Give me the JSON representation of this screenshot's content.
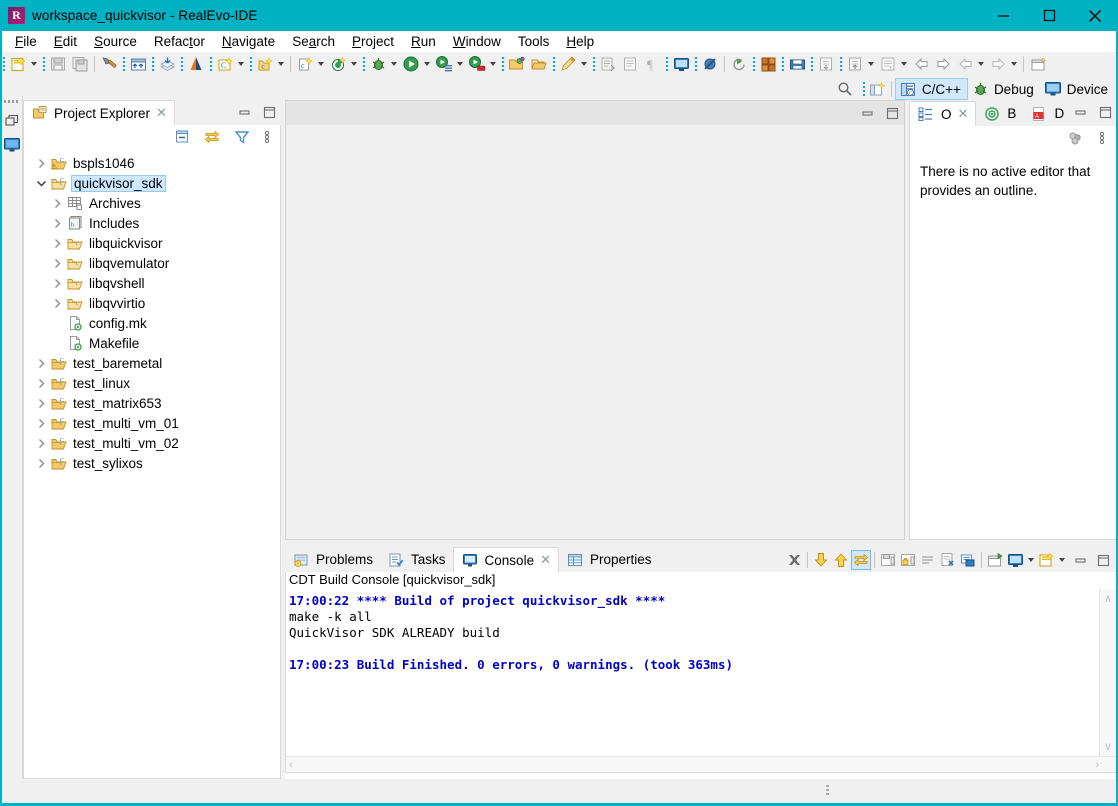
{
  "window": {
    "title": "workspace_quickvisor - RealEvo-IDE",
    "logo_letter": "R",
    "minimize": "—",
    "maximize": "□",
    "close": "✕",
    "accent_color": "#00b2c2"
  },
  "menubar": {
    "items": [
      {
        "label": "File",
        "mnemonic": "F"
      },
      {
        "label": "Edit",
        "mnemonic": "E"
      },
      {
        "label": "Source",
        "mnemonic": "S"
      },
      {
        "label": "Refactor",
        "mnemonic": "t"
      },
      {
        "label": "Navigate",
        "mnemonic": "N"
      },
      {
        "label": "Search",
        "mnemonic": "a"
      },
      {
        "label": "Project",
        "mnemonic": "P"
      },
      {
        "label": "Run",
        "mnemonic": "R"
      },
      {
        "label": "Window",
        "mnemonic": "W"
      },
      {
        "label": "Tools",
        "mnemonic": ""
      },
      {
        "label": "Help",
        "mnemonic": "H"
      }
    ]
  },
  "toolbar": {
    "groups": [
      {
        "items": [
          {
            "icon": "new-wizard-icon",
            "arrow": true
          },
          {
            "icon": "save-icon",
            "arrow": false
          },
          {
            "icon": "save-all-icon",
            "arrow": false
          }
        ]
      },
      {
        "items": [
          {
            "icon": "build-hammer-icon",
            "arrow": false
          }
        ]
      },
      {
        "items": [
          {
            "icon": "build-all-icon",
            "arrow": false
          }
        ]
      },
      {
        "items": [
          {
            "icon": "publish-icon",
            "arrow": false
          }
        ]
      },
      {
        "items": [
          {
            "icon": "realevo-tool-icon",
            "arrow": false
          }
        ]
      },
      {
        "items": [
          {
            "icon": "new-c-project-icon",
            "arrow": true
          }
        ]
      },
      {
        "items": [
          {
            "icon": "new-c-class-icon",
            "arrow": true
          }
        ]
      },
      {
        "items": [
          {
            "icon": "new-c-file-icon",
            "arrow": true
          }
        ]
      },
      {
        "items": [
          {
            "icon": "new-grid-icon",
            "arrow": true
          }
        ]
      },
      {
        "items": [
          {
            "icon": "debug-bug-icon",
            "arrow": true
          },
          {
            "icon": "run-icon",
            "arrow": true
          },
          {
            "icon": "run-config-icon",
            "arrow": true
          },
          {
            "icon": "run-stop-icon",
            "arrow": true
          }
        ]
      },
      {
        "items": [
          {
            "icon": "open-type-icon",
            "arrow": false
          },
          {
            "icon": "open-resource-icon",
            "arrow": false
          }
        ]
      },
      {
        "items": [
          {
            "icon": "pencil-marker-icon",
            "arrow": true
          }
        ]
      },
      {
        "items": [
          {
            "icon": "next-annotation-icon",
            "arrow": false
          },
          {
            "icon": "last-edit-icon",
            "arrow": false
          },
          {
            "icon": "pilcrow-icon",
            "arrow": false
          }
        ]
      },
      {
        "items": [
          {
            "icon": "console-monitor-icon",
            "arrow": false
          }
        ]
      },
      {
        "items": [
          {
            "icon": "skip-breakpoints-icon",
            "arrow": false
          }
        ]
      },
      {
        "items": [
          {
            "icon": "refresh-arrow-icon",
            "arrow": false
          }
        ]
      },
      {
        "items": [
          {
            "icon": "cube-package-icon",
            "arrow": false
          }
        ]
      },
      {
        "items": [
          {
            "icon": "save-folder-icon",
            "arrow": false
          }
        ]
      },
      {
        "items": [
          {
            "icon": "import-icon",
            "arrow": false
          }
        ]
      },
      {
        "items": [
          {
            "icon": "export-icon",
            "arrow": true
          }
        ]
      },
      {
        "items": [
          {
            "icon": "terminal-icon",
            "arrow": true
          }
        ]
      },
      {
        "items": [
          {
            "icon": "back-history-icon",
            "arrow": false
          },
          {
            "icon": "forward-history-icon",
            "arrow": false
          },
          {
            "icon": "previous-icon",
            "arrow": true
          },
          {
            "icon": "next-icon",
            "arrow": true
          }
        ]
      },
      {
        "items": [
          {
            "icon": "new-editor-icon",
            "arrow": false
          }
        ]
      }
    ]
  },
  "perspective_bar": {
    "search_icon": "search-icon",
    "open_perspective_icon": "open-perspective-icon",
    "items": [
      {
        "label": "C/C++",
        "icon": "c-cpp-perspective-icon",
        "active": true
      },
      {
        "label": "Debug",
        "icon": "debug-perspective-icon",
        "active": false
      },
      {
        "label": "Device",
        "icon": "device-perspective-icon",
        "active": false
      }
    ]
  },
  "fast_view_bar": {
    "icons": [
      "restore-view-icon",
      "device-monitor-icon"
    ]
  },
  "project_explorer": {
    "tab_label": "Project Explorer",
    "tab_icon": "project-explorer-icon",
    "close_glyph": "✕",
    "toolbar_icons": [
      "collapse-all-icon",
      "link-with-editor-icon",
      "filter-icon",
      "view-menu-icon"
    ],
    "minimize_tooltip": "Minimize",
    "maximize_tooltip": "Maximize",
    "tree": [
      {
        "label": "bspls1046",
        "icon": "c-project-warning-icon",
        "indent": 0,
        "twisty": "collapsed",
        "selected": false
      },
      {
        "label": "quickvisor_sdk",
        "icon": "c-project-open-icon",
        "indent": 0,
        "twisty": "expanded",
        "selected": true
      },
      {
        "label": "Archives",
        "icon": "archives-icon",
        "indent": 1,
        "twisty": "collapsed",
        "selected": false
      },
      {
        "label": "Includes",
        "icon": "includes-icon",
        "indent": 1,
        "twisty": "collapsed",
        "selected": false
      },
      {
        "label": "libquickvisor",
        "icon": "folder-icon",
        "indent": 1,
        "twisty": "collapsed",
        "selected": false
      },
      {
        "label": "libqvemulator",
        "icon": "folder-icon",
        "indent": 1,
        "twisty": "collapsed",
        "selected": false
      },
      {
        "label": "libqvshell",
        "icon": "folder-icon",
        "indent": 1,
        "twisty": "collapsed",
        "selected": false
      },
      {
        "label": "libqvvirtio",
        "icon": "folder-icon",
        "indent": 1,
        "twisty": "collapsed",
        "selected": false
      },
      {
        "label": "config.mk",
        "icon": "makefile-icon",
        "indent": 1,
        "twisty": "none",
        "selected": false
      },
      {
        "label": "Makefile",
        "icon": "makefile-icon",
        "indent": 1,
        "twisty": "none",
        "selected": false
      },
      {
        "label": "test_baremetal",
        "icon": "c-project-icon",
        "indent": 0,
        "twisty": "collapsed",
        "selected": false
      },
      {
        "label": "test_linux",
        "icon": "c-project-icon",
        "indent": 0,
        "twisty": "collapsed",
        "selected": false
      },
      {
        "label": "test_matrix653",
        "icon": "c-project-icon",
        "indent": 0,
        "twisty": "collapsed",
        "selected": false
      },
      {
        "label": "test_multi_vm_01",
        "icon": "c-project-icon",
        "indent": 0,
        "twisty": "collapsed",
        "selected": false
      },
      {
        "label": "test_multi_vm_02",
        "icon": "c-project-icon",
        "indent": 0,
        "twisty": "collapsed",
        "selected": false
      },
      {
        "label": "test_sylixos",
        "icon": "c-project-icon",
        "indent": 0,
        "twisty": "collapsed",
        "selected": false
      }
    ]
  },
  "editor_area": {
    "empty": true
  },
  "outline": {
    "tabs": [
      {
        "label": "O",
        "icon": "outline-icon",
        "active": true,
        "close_glyph": "✕"
      },
      {
        "label": "B",
        "icon": "build-targets-icon",
        "active": false
      },
      {
        "label": "D",
        "icon": "documents-pdf-icon",
        "active": false
      }
    ],
    "toolbar_icons": [
      "sort-group-icon",
      "view-menu-icon"
    ],
    "message": "There is no active editor that provides an outline."
  },
  "console": {
    "tabs": [
      {
        "label": "Problems",
        "icon": "problems-icon",
        "active": false
      },
      {
        "label": "Tasks",
        "icon": "tasks-icon",
        "active": false
      },
      {
        "label": "Console",
        "icon": "console-icon",
        "active": true,
        "close_glyph": "✕"
      },
      {
        "label": "Properties",
        "icon": "properties-icon",
        "active": false
      }
    ],
    "toolbar_icons": [
      "terminate-icon",
      "scroll-down-icon",
      "scroll-up-icon",
      "scroll-lock-icon",
      "save-console-icon",
      "lock-console-icon",
      "clear-console-icon",
      "close-console-icon",
      "open-console-icon",
      "pin-console-icon",
      "display-console-icon",
      "new-console-icon"
    ],
    "sub_label": "CDT Build Console [quickvisor_sdk]",
    "lines": [
      {
        "text": "17:00:22 **** Build of project quickvisor_sdk ****",
        "style": "blue"
      },
      {
        "text": "make -k all",
        "style": "black"
      },
      {
        "text": "QuickVisor SDK ALREADY build",
        "style": "black"
      },
      {
        "text": "",
        "style": "black"
      },
      {
        "text": "17:00:23 Build Finished. 0 errors, 0 warnings. (took 363ms)",
        "style": "blue"
      }
    ],
    "scroll_up_glyph": "∧",
    "scroll_down_glyph": "∨",
    "scroll_left_glyph": "‹",
    "scroll_right_glyph": "›"
  }
}
